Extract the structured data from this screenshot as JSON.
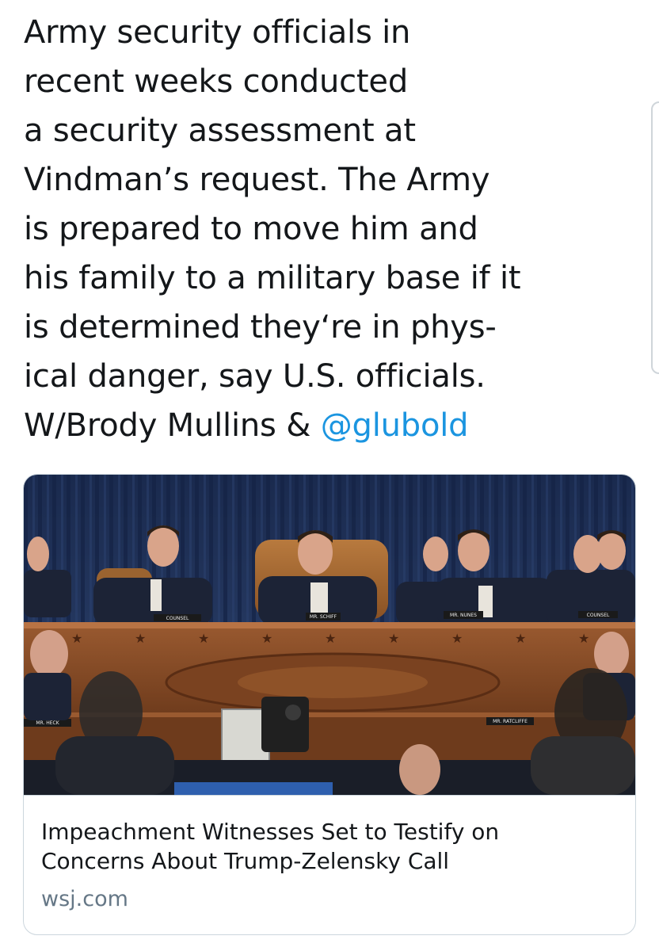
{
  "tweet": {
    "lines": [
      "Army security officials in",
      "recent weeks conducted",
      "a security assessment at",
      "Vindman’s request. The Army",
      "is prepared to move him and",
      "his family to a military base if it",
      "is determined they‘re in phys-",
      "ical danger, say U.S. officials."
    ],
    "last_line_prefix": "W/Brody Mullins & ",
    "mention": "@glubold"
  },
  "card": {
    "image_nameplates": {
      "counsel_left": "COUNSEL",
      "schiff": "MR. SCHIFF",
      "nunes": "MR. NUNES",
      "counsel_right": "COUNSEL",
      "heck": "MR. HECK",
      "ratcliffe": "MR. RATCLIFFE"
    },
    "title_lines": [
      "Impeachment Witnesses Set to Testify on",
      "Concerns About Trump-Zelensky Call"
    ],
    "domain": "wsj.com"
  },
  "colors": {
    "text": "#14171a",
    "mention": "#1b95e0",
    "secondary": "#657786",
    "card_border": "#ccd6dd"
  }
}
